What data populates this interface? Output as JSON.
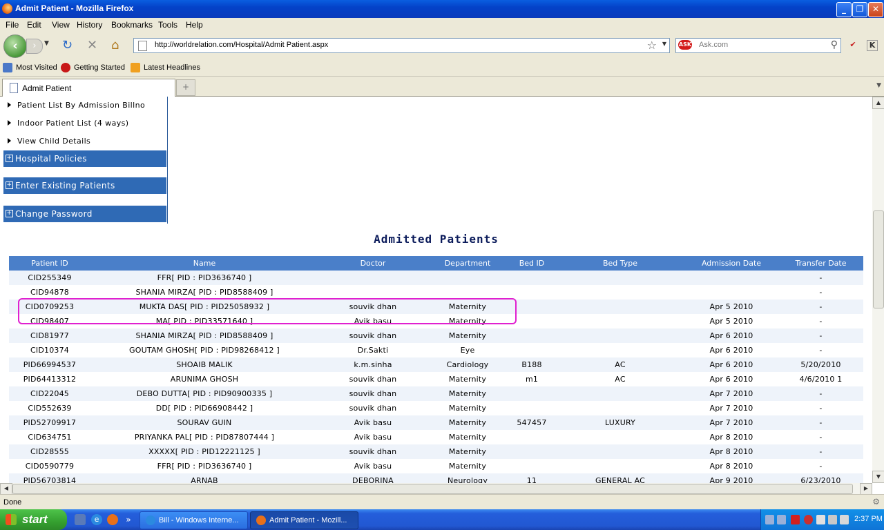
{
  "window": {
    "title": "Admit Patient - Mozilla Firefox"
  },
  "menu": [
    "File",
    "Edit",
    "View",
    "History",
    "Bookmarks",
    "Tools",
    "Help"
  ],
  "nav": {
    "url": "http://worldrelation.com/Hospital/Admit Patient.aspx",
    "search_placeholder": "Ask.com",
    "search_engine": "ASK"
  },
  "bookmarks": [
    "Most Visited",
    "Getting Started",
    "Latest Headlines"
  ],
  "tab": {
    "label": "Admit Patient"
  },
  "sidebar": {
    "links": [
      "Patient List By Admission Billno",
      "Indoor Patient List (4 ways)",
      "View Child Details"
    ],
    "sections": [
      "Hospital Policies",
      "Enter Existing Patients",
      "Change Password"
    ]
  },
  "page": {
    "heading": "Admitted Patients"
  },
  "table": {
    "columns": [
      "Patient ID",
      "Name",
      "Doctor",
      "Department",
      "Bed ID",
      "Bed Type",
      "Admission Date",
      "Transfer Date"
    ],
    "rows": [
      [
        "CID255349",
        "FFR[ PID : PID3636740 ]",
        "",
        "",
        "",
        "",
        "",
        "-"
      ],
      [
        "CID94878",
        "SHANIA MIRZA[ PID : PID8588409 ]",
        "",
        "",
        "",
        "",
        "",
        "-"
      ],
      [
        "CID0709253",
        "MUKTA DAS[ PID : PID25058932 ]",
        "souvik dhan",
        "Maternity",
        "",
        "",
        "Apr 5 2010",
        "-"
      ],
      [
        "CID98407",
        "MA[ PID : PID33571640 ]",
        "Avik basu",
        "Maternity",
        "",
        "",
        "Apr 5 2010",
        "-"
      ],
      [
        "CID81977",
        "SHANIA MIRZA[ PID : PID8588409 ]",
        "souvik dhan",
        "Maternity",
        "",
        "",
        "Apr 6 2010",
        "-"
      ],
      [
        "CID10374",
        "GOUTAM GHOSH[ PID : PID98268412 ]",
        "Dr.Sakti",
        "Eye",
        "",
        "",
        "Apr 6 2010",
        "-"
      ],
      [
        "PID66994537",
        "SHOAIB MALIK",
        "k.m.sinha",
        "Cardiology",
        "B188",
        "AC",
        "Apr 6 2010",
        "5/20/2010"
      ],
      [
        "PID64413312",
        "ARUNIMA GHOSH",
        "souvik dhan",
        "Maternity",
        "m1",
        "AC",
        "Apr 6 2010",
        "4/6/2010 1"
      ],
      [
        "CID22045",
        "DEBO DUTTA[ PID : PID90900335 ]",
        "souvik dhan",
        "Maternity",
        "",
        "",
        "Apr 7 2010",
        "-"
      ],
      [
        "CID552639",
        "DD[ PID : PID66908442 ]",
        "souvik dhan",
        "Maternity",
        "",
        "",
        "Apr 7 2010",
        "-"
      ],
      [
        "PID52709917",
        "SOURAV GUIN",
        "Avik basu",
        "Maternity",
        "547457",
        "LUXURY",
        "Apr 7 2010",
        "-"
      ],
      [
        "CID634751",
        "PRIYANKA PAL[ PID : PID87807444 ]",
        "Avik basu",
        "Maternity",
        "",
        "",
        "Apr 8 2010",
        "-"
      ],
      [
        "CID28555",
        "XXXXX[ PID : PID12221125 ]",
        "souvik dhan",
        "Maternity",
        "",
        "",
        "Apr 8 2010",
        "-"
      ],
      [
        "CID0590779",
        "FFR[ PID : PID3636740 ]",
        "Avik basu",
        "Maternity",
        "",
        "",
        "Apr 8 2010",
        "-"
      ],
      [
        "PID56703814",
        "ARNAB",
        "DEBORINA",
        "Neurology",
        "11",
        "GENERAL AC",
        "Apr 9 2010",
        "6/23/2010"
      ]
    ]
  },
  "status": {
    "text": "Done"
  },
  "taskbar": {
    "start": "start",
    "tasks": [
      "Bill - Windows Interne...",
      "Admit Patient - Mozill..."
    ],
    "clock": "2:37 PM"
  },
  "colors": {
    "table_header": "#4a7fc9",
    "sidebar_header": "#2f6ab5",
    "highlight": "#e020d0"
  }
}
